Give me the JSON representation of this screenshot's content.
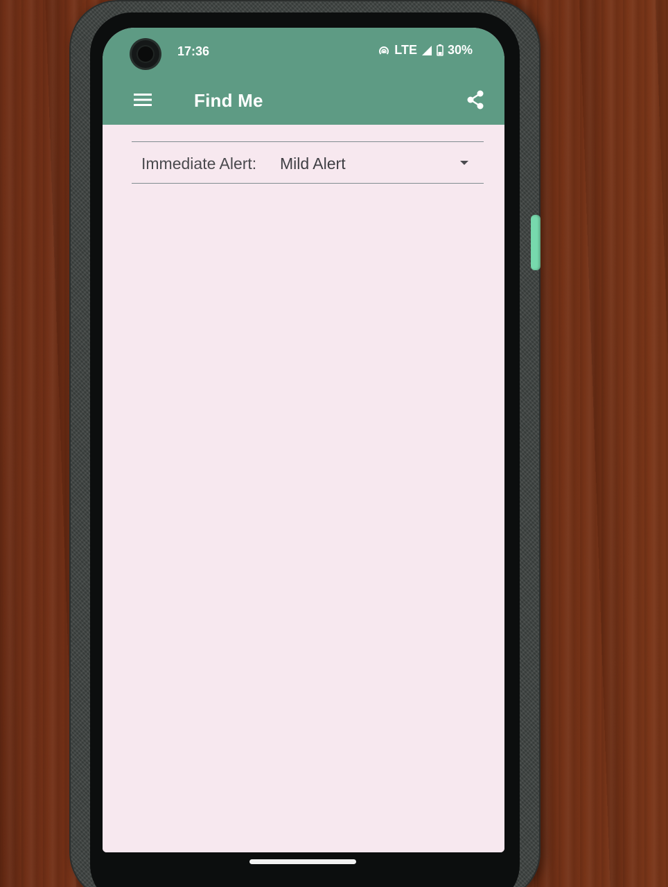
{
  "status_bar": {
    "time": "17:36",
    "network": "LTE",
    "battery": "30%"
  },
  "app_bar": {
    "title": "Find Me",
    "menu_icon": "menu-icon",
    "share_icon": "share-icon"
  },
  "alert": {
    "label": "Immediate Alert:",
    "selected": "Mild Alert"
  },
  "colors": {
    "toolbar": "#5e9b84",
    "background": "#f7e8ef"
  }
}
